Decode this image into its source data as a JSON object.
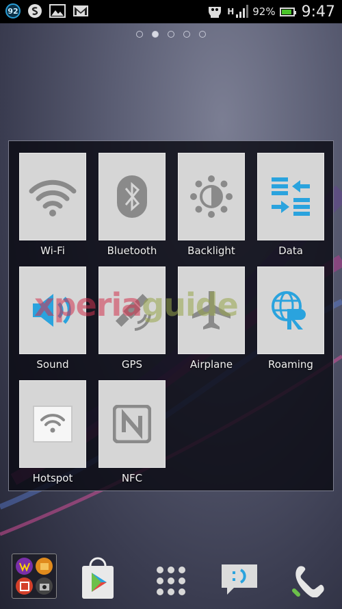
{
  "status_bar": {
    "notification_count": "92",
    "network_type": "H",
    "battery_percent": "92%",
    "battery_level": 0.92,
    "time": "9:47",
    "icons": [
      "notification-count-icon",
      "skype-icon",
      "gallery-icon",
      "gmail-icon",
      "usb-debug-icon",
      "network-h-icon",
      "signal-icon",
      "battery-icon"
    ]
  },
  "home_pages": {
    "count": 5,
    "active_index": 1
  },
  "quick_settings": {
    "tiles": [
      {
        "label": "Wi-Fi",
        "icon": "wifi-icon"
      },
      {
        "label": "Bluetooth",
        "icon": "bluetooth-icon"
      },
      {
        "label": "Backlight",
        "icon": "brightness-icon"
      },
      {
        "label": "Data",
        "icon": "data-transfer-icon"
      },
      {
        "label": "Sound",
        "icon": "speaker-icon"
      },
      {
        "label": "GPS",
        "icon": "gps-icon"
      },
      {
        "label": "Airplane",
        "icon": "airplane-icon"
      },
      {
        "label": "Roaming",
        "icon": "roaming-icon"
      },
      {
        "label": "Hotspot",
        "icon": "hotspot-icon"
      },
      {
        "label": "NFC",
        "icon": "nfc-icon"
      }
    ]
  },
  "watermark": {
    "part1": "xperia",
    "part2": "guide"
  },
  "dock": {
    "items": [
      "media-folder-icon",
      "play-store-icon",
      "app-drawer-icon",
      "messaging-icon",
      "phone-icon"
    ]
  },
  "colors": {
    "accent_blue": "#2aa3de",
    "tile_bg": "#d6d6d6",
    "icon_gray": "#8a8a8a",
    "battery_green": "#4ac42a"
  }
}
